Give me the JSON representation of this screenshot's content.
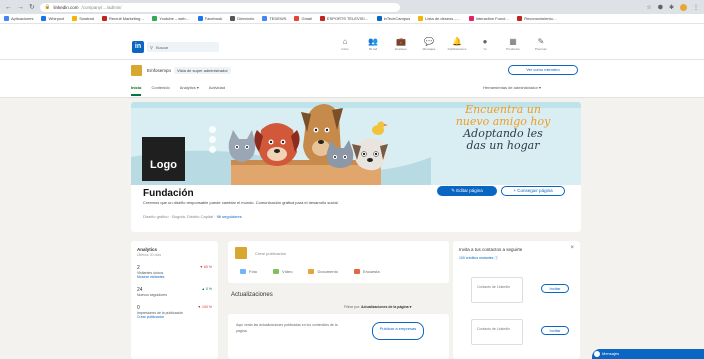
{
  "browser": {
    "url_host": "linkedin.com",
    "url_path": "/company/…/admin/",
    "bookmarks": [
      {
        "label": "Aplicaciones",
        "color": "#4285f4"
      },
      {
        "label": "Whirpool",
        "color": "#1a73e8"
      },
      {
        "label": "Sowtrad",
        "color": "#f4b400"
      },
      {
        "label": "Recruit Marketing…",
        "color": "#c5221f"
      },
      {
        "label": "Youtube – web…",
        "color": "#34a853"
      },
      {
        "label": "Facebook",
        "color": "#1877f2"
      },
      {
        "label": "Directorio",
        "color": "#555555"
      },
      {
        "label": "TEDEWS",
        "color": "#4285f4"
      },
      {
        "label": "Gmail",
        "color": "#ea4335"
      },
      {
        "label": "ESPORTS TELEVISI…",
        "color": "#c5221f"
      },
      {
        "label": "InTechCampus",
        "color": "#0a66c2"
      },
      {
        "label": "Lista de deseos –…",
        "color": "#f4b400"
      },
      {
        "label": "Interactive Funct…",
        "color": "#e91e63"
      },
      {
        "label": "Reconocimiento…",
        "color": "#c5221f"
      }
    ]
  },
  "linkedin": {
    "logo_text": "in",
    "search_placeholder": "Buscar",
    "nav": [
      {
        "icon": "home-icon",
        "glyph": "⌂",
        "label": "Inicio"
      },
      {
        "icon": "network-icon",
        "glyph": "👥",
        "label": "Mi red"
      },
      {
        "icon": "jobs-icon",
        "glyph": "💼",
        "label": "Empleos"
      },
      {
        "icon": "messaging-icon",
        "glyph": "💬",
        "label": "Mensajes"
      },
      {
        "icon": "notifications-icon",
        "glyph": "🔔",
        "label": "Notificaciones"
      },
      {
        "icon": "me-icon",
        "glyph": "●",
        "label": "Yo"
      },
      {
        "icon": "grid-icon",
        "glyph": "▦",
        "label": "Productos"
      },
      {
        "icon": "premium-icon",
        "glyph": "✎",
        "label": "Premium"
      }
    ]
  },
  "page_header": {
    "name": "Emfosempo",
    "role": "Vista de super administrador",
    "view_button": "Ver como miembro",
    "tabs": [
      "Inicio",
      "Contenido",
      "Analytics ▾",
      "Actividad"
    ],
    "tools": "Herramientas de administrador ▾"
  },
  "cover": {
    "line1": "Encuentra un",
    "line2": "nuevo amigo hoy",
    "line3": "Adoptando les",
    "line4": "das un hogar",
    "logo_text": "Logo"
  },
  "profile": {
    "name": "Fundación",
    "description": "Creemos que un diseño responsable puede cambiar el mundo. Comunicación gráfica para el desarrollo social.",
    "meta": "Diseño gráfico · Bogotá, Distrito Capital",
    "meta_link": "96 seguidores",
    "edit_button": "✎ Editar página",
    "follow_button": "+ Conseguir página"
  },
  "analytics": {
    "title": "Analytics",
    "subtitle": "Últimos 30 días",
    "rows": [
      {
        "num": "2",
        "label": "Visitantes únicos",
        "delta": "▼ 60 %",
        "up": false,
        "link": "Mostrar visitantes"
      },
      {
        "num": "24",
        "label": "Nuevos seguidores",
        "delta": "▲ 0 %",
        "up": true,
        "link": ""
      },
      {
        "num": "0",
        "label": "Impresiones de la publicación",
        "delta": "▼ 100 %",
        "up": false,
        "link": "Crear publicación"
      }
    ]
  },
  "composer": {
    "placeholder": "Crear publicación",
    "actions": [
      {
        "label": "Foto",
        "color": "#70b5f9"
      },
      {
        "label": "Vídeo",
        "color": "#7fc15e"
      },
      {
        "label": "Documento",
        "color": "#e7a33e"
      },
      {
        "label": "Encuesta",
        "color": "#e16745"
      }
    ]
  },
  "updates": {
    "header": "Actualizaciones",
    "sort_label": "Filtrar por:",
    "sort_value": "Actualizaciones de la página ▾",
    "empty_text": "Aquí verás las actualizaciones publicadas en los contenidos de la página.",
    "cta": "Publicar a empresas"
  },
  "suggestions": {
    "title": "Invita a tus contactos a seguirte",
    "subtitle": "100 créditos restantes ⓘ",
    "items": [
      {
        "label": "Contacto de LinkedIn",
        "invite": "Invitar"
      },
      {
        "label": "Contacto de LinkedIn",
        "invite": "Invitar"
      }
    ]
  },
  "messaging": {
    "label": "Mensajes"
  }
}
